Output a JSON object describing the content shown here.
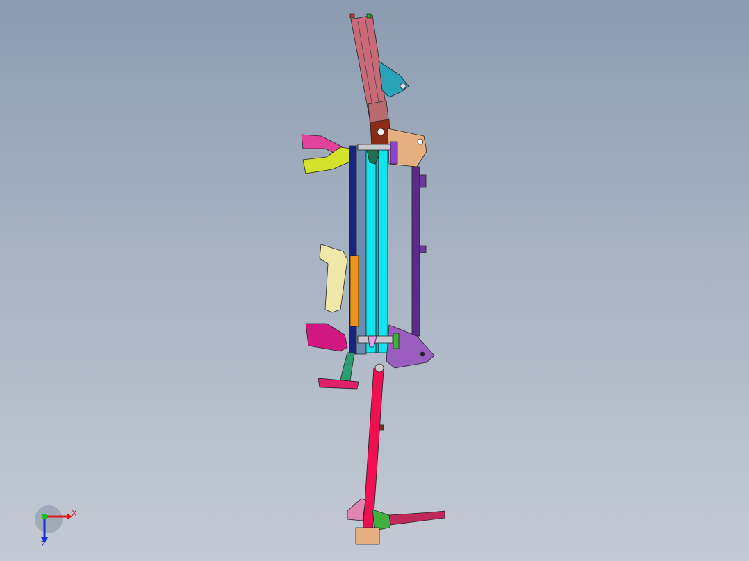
{
  "viewport": {
    "background_top": "#8c9cb0",
    "background_bottom": "#c4cad4"
  },
  "triad": {
    "x_label": "X",
    "z_label": "Z",
    "x_color": "#e01818",
    "y_color": "#18c018",
    "z_color": "#1830d0"
  },
  "model": {
    "part_colors": [
      "#c86a78",
      "#2aa3b8",
      "#8a2c16",
      "#e7b081",
      "#e1439c",
      "#d4e22c",
      "#1b237f",
      "#10e6ee",
      "#28a0c0",
      "#5b2a8a",
      "#9a5ec0",
      "#ec9418",
      "#f0e8a8",
      "#d01880",
      "#2aa070",
      "#ee1050",
      "#6c3820",
      "#e084b0",
      "#40b040",
      "#c0285a"
    ]
  }
}
